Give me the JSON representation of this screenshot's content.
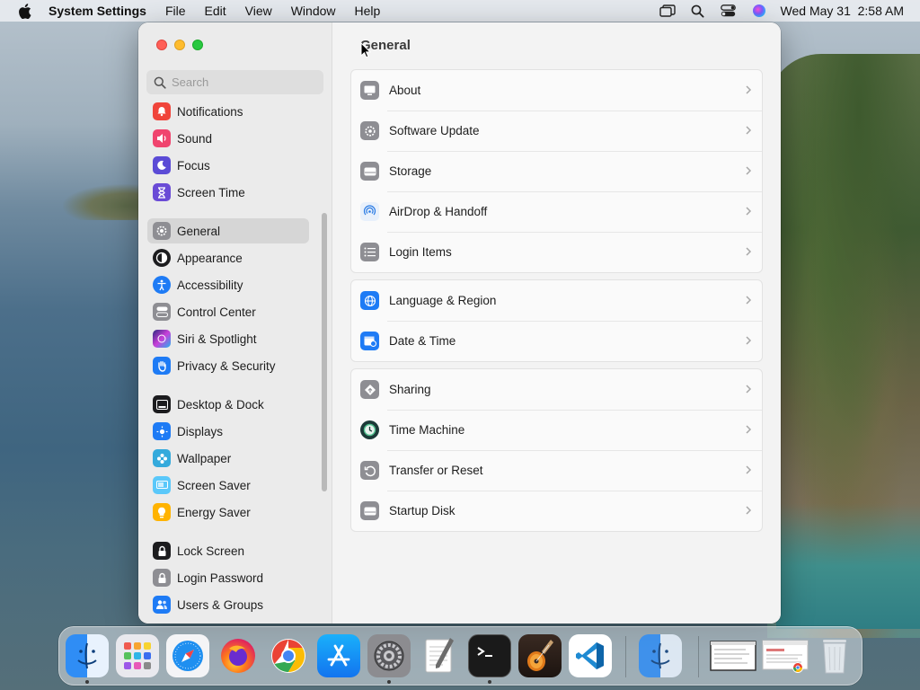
{
  "menubar": {
    "app_name": "System Settings",
    "menus": [
      "File",
      "Edit",
      "View",
      "Window",
      "Help"
    ],
    "clock": "Wed May 31  2:58 AM"
  },
  "window": {
    "search_placeholder": "Search",
    "sidebar": {
      "items": [
        {
          "label": "Notifications",
          "icon": "bell-icon",
          "color": "#f0443a"
        },
        {
          "label": "Sound",
          "icon": "speaker-icon",
          "color": "#f0446e"
        },
        {
          "label": "Focus",
          "icon": "moon-icon",
          "color": "#5b4bd6"
        },
        {
          "label": "Screen Time",
          "icon": "hourglass-icon",
          "color": "#6a4bd6"
        },
        {
          "label": "General",
          "icon": "gear-icon",
          "color": "#8e8e93",
          "selected": true
        },
        {
          "label": "Appearance",
          "icon": "appearance-icon",
          "color": "#1c1c1e"
        },
        {
          "label": "Accessibility",
          "icon": "accessibility-icon",
          "color": "#1e7bf5"
        },
        {
          "label": "Control Center",
          "icon": "toggles-icon",
          "color": "#8e8e93"
        },
        {
          "label": "Siri & Spotlight",
          "icon": "siri-icon",
          "color": "#8e38d8"
        },
        {
          "label": "Privacy & Security",
          "icon": "hand-icon",
          "color": "#1e7bf5"
        },
        {
          "label": "Desktop & Dock",
          "icon": "dock-icon",
          "color": "#1c1c1e"
        },
        {
          "label": "Displays",
          "icon": "sun-icon",
          "color": "#1e7bf5"
        },
        {
          "label": "Wallpaper",
          "icon": "flower-icon",
          "color": "#34aadc"
        },
        {
          "label": "Screen Saver",
          "icon": "screensaver-icon",
          "color": "#5ac8fa"
        },
        {
          "label": "Energy Saver",
          "icon": "bulb-icon",
          "color": "#ffb300"
        },
        {
          "label": "Lock Screen",
          "icon": "lock-icon",
          "color": "#1c1c1e"
        },
        {
          "label": "Login Password",
          "icon": "lock-icon",
          "color": "#8e8e93"
        },
        {
          "label": "Users & Groups",
          "icon": "users-icon",
          "color": "#1e7bf5"
        }
      ]
    },
    "main": {
      "title": "General",
      "groups": [
        [
          {
            "label": "About",
            "icon": "display-icon",
            "color": "#8e8e93"
          },
          {
            "label": "Software Update",
            "icon": "gear-badge-icon",
            "color": "#8e8e93"
          },
          {
            "label": "Storage",
            "icon": "drive-icon",
            "color": "#8e8e93"
          },
          {
            "label": "AirDrop & Handoff",
            "icon": "airdrop-icon",
            "color": "#e8f0fb"
          },
          {
            "label": "Login Items",
            "icon": "list-icon",
            "color": "#8e8e93"
          }
        ],
        [
          {
            "label": "Language & Region",
            "icon": "globe-icon",
            "color": "#1e7bf5"
          },
          {
            "label": "Date & Time",
            "icon": "calendar-icon",
            "color": "#1e7bf5"
          }
        ],
        [
          {
            "label": "Sharing",
            "icon": "sharing-icon",
            "color": "#8e8e93"
          },
          {
            "label": "Time Machine",
            "icon": "time-machine-icon",
            "color": "#1c3a38"
          },
          {
            "label": "Transfer or Reset",
            "icon": "reset-icon",
            "color": "#8e8e93"
          },
          {
            "label": "Startup Disk",
            "icon": "disk-icon",
            "color": "#8e8e93"
          }
        ]
      ]
    }
  },
  "dock": {
    "apps": [
      "finder-icon",
      "launchpad-icon",
      "safari-icon",
      "firefox-icon",
      "chrome-icon",
      "app-store-icon",
      "system-settings-icon",
      "textedit-icon",
      "terminal-icon",
      "garageband-icon",
      "vscode-icon",
      "finder-icon",
      "window-thumbnail-icon",
      "chrome-window-thumbnail-icon",
      "trash-icon"
    ]
  }
}
